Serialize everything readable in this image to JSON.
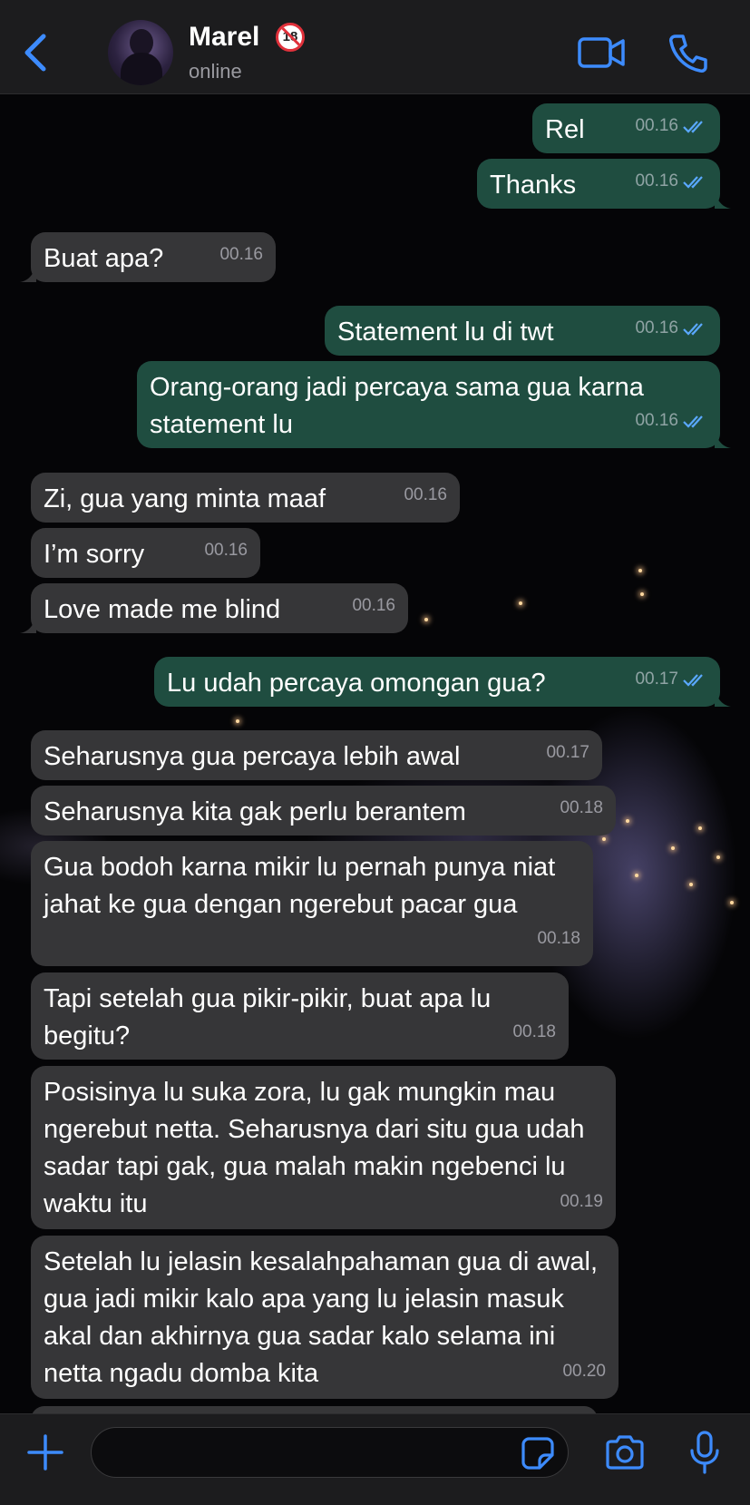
{
  "header": {
    "contact_name": "Marel",
    "age_badge": "18",
    "status": "online"
  },
  "messages": [
    {
      "text": "Rel",
      "time": "00.16",
      "dir": "out"
    },
    {
      "text": "Thanks",
      "time": "00.16",
      "dir": "out"
    },
    {
      "text": "Buat apa?",
      "time": "00.16",
      "dir": "in"
    },
    {
      "text": "Statement lu di twt",
      "time": "00.16",
      "dir": "out"
    },
    {
      "text": "Orang-orang jadi percaya sama gua karna statement lu",
      "time": "00.16",
      "dir": "out"
    },
    {
      "text": "Zi, gua yang minta maaf",
      "time": "00.16",
      "dir": "in"
    },
    {
      "text": "I’m sorry",
      "time": "00.16",
      "dir": "in"
    },
    {
      "text": "Love made me blind",
      "time": "00.16",
      "dir": "in"
    },
    {
      "text": "Lu udah percaya omongan gua?",
      "time": "00.17",
      "dir": "out"
    },
    {
      "text": "Seharusnya gua percaya lebih awal",
      "time": "00.17",
      "dir": "in"
    },
    {
      "text": "Seharusnya kita gak perlu berantem",
      "time": "00.18",
      "dir": "in"
    },
    {
      "text": "Gua bodoh karna mikir lu pernah punya niat jahat ke gua dengan ngerebut pacar gua",
      "time": "00.18",
      "dir": "in"
    },
    {
      "text": "Tapi setelah gua pikir-pikir, buat apa lu begitu?",
      "time": "00.18",
      "dir": "in"
    },
    {
      "text": "Posisinya lu suka zora, lu gak mungkin mau ngerebut netta. Seharusnya dari situ gua udah sadar tapi gak, gua malah makin ngebenci lu waktu itu",
      "time": "00.19",
      "dir": "in"
    },
    {
      "text": "Setelah lu jelasin kesalahpahaman gua di awal, gua jadi mikir kalo apa yang lu jelasin masuk akal dan akhirnya gua sadar kalo selama ini netta ngadu domba kita",
      "time": "00.20",
      "dir": "in"
    }
  ],
  "composer": {
    "value": "",
    "placeholder": ""
  },
  "colors": {
    "accent": "#3d8bfd",
    "outgoing_bubble": "#1f4d40",
    "incoming_bubble": "#363638",
    "read_ticks": "#5aa8ff"
  },
  "icons": [
    "back-icon",
    "video-call-icon",
    "phone-icon",
    "plus-icon",
    "sticker-icon",
    "camera-icon",
    "microphone-icon"
  ]
}
